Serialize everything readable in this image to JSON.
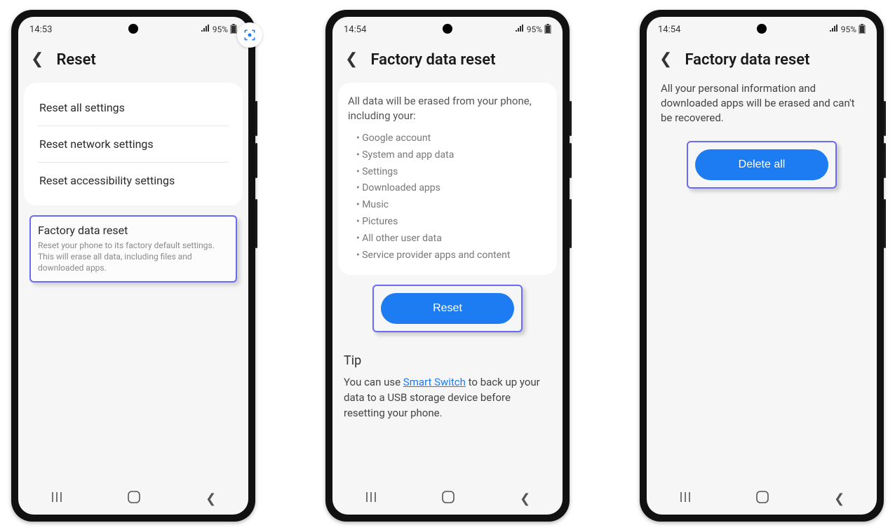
{
  "screen1": {
    "status": {
      "time": "14:53",
      "battery": "95%"
    },
    "title": "Reset",
    "items": [
      {
        "label": "Reset all settings"
      },
      {
        "label": "Reset network settings"
      },
      {
        "label": "Reset accessibility settings"
      }
    ],
    "factory": {
      "title": "Factory data reset",
      "sub": "Reset your phone to its factory default settings. This will erase all data, including files and downloaded apps."
    }
  },
  "screen2": {
    "status": {
      "time": "14:54",
      "battery": "95%"
    },
    "title": "Factory data reset",
    "desc": "All data will be erased from your phone, including your:",
    "bullets": [
      "Google account",
      "System and app data",
      "Settings",
      "Downloaded apps",
      "Music",
      "Pictures",
      "All other user data",
      "Service provider apps and content"
    ],
    "reset_btn": "Reset",
    "tip_head": "Tip",
    "tip_pre": "You can use ",
    "tip_link": "Smart Switch",
    "tip_post": " to back up your data to a USB storage device before resetting your phone."
  },
  "screen3": {
    "status": {
      "time": "14:54",
      "battery": "95%"
    },
    "title": "Factory data reset",
    "warn": "All your personal information and downloaded apps will be erased and can't be recovered.",
    "delete_btn": "Delete all"
  }
}
